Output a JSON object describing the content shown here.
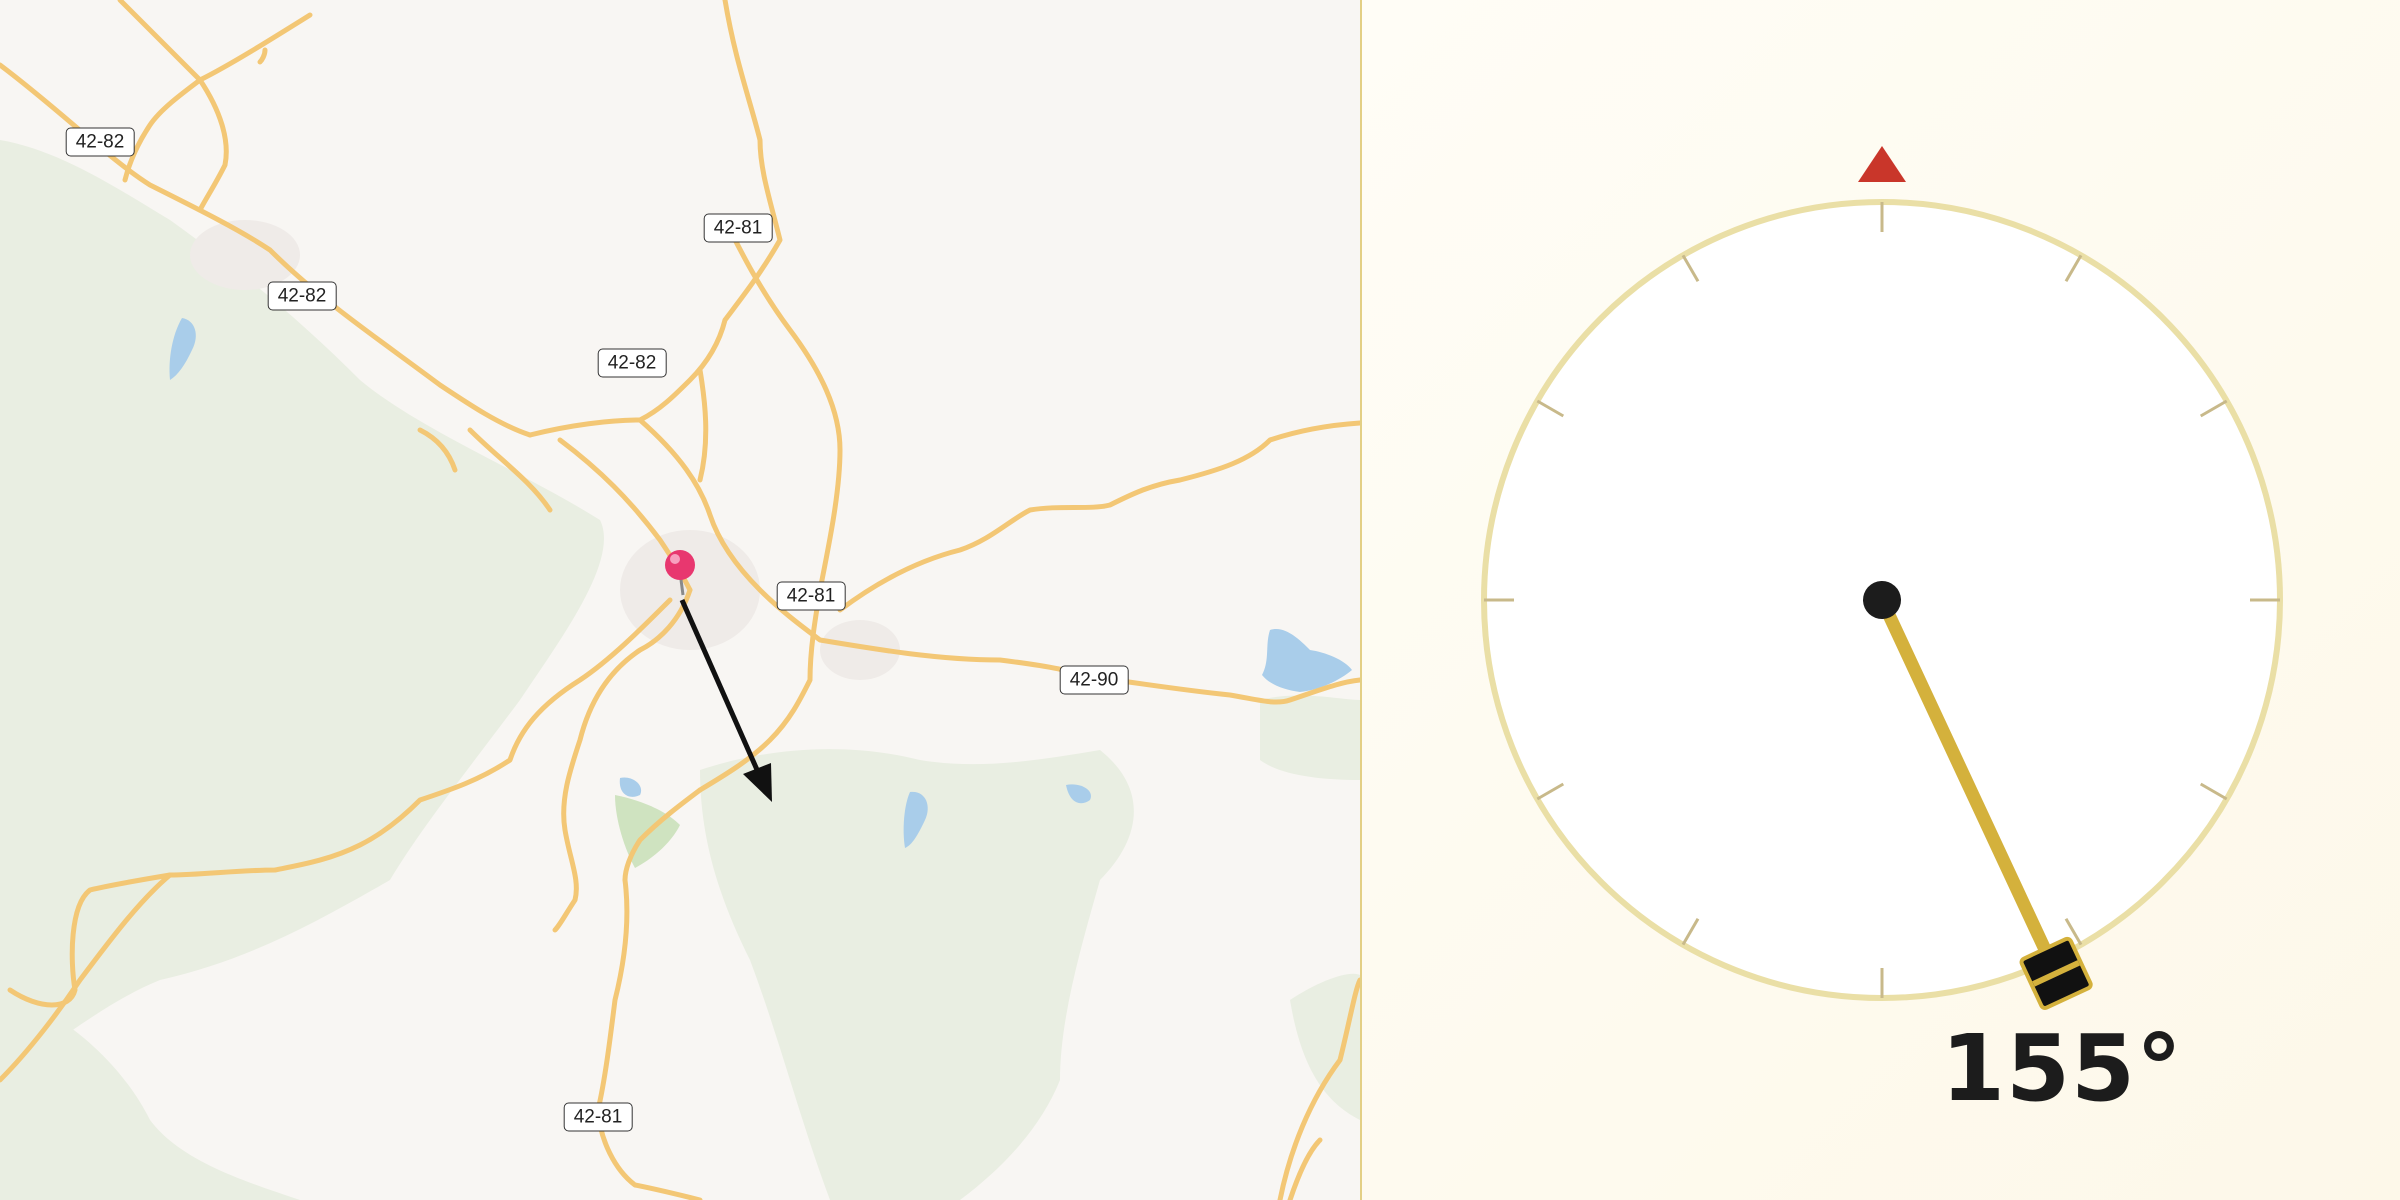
{
  "map": {
    "route_shields": [
      {
        "id": "s1",
        "label": "42-82"
      },
      {
        "id": "s2",
        "label": "42-82"
      },
      {
        "id": "s3",
        "label": "42-82"
      },
      {
        "id": "s4",
        "label": "42-81"
      },
      {
        "id": "s5",
        "label": "42-81"
      },
      {
        "id": "s6",
        "label": "42-90"
      },
      {
        "id": "s7",
        "label": "42-81"
      }
    ],
    "pin_color": "#e8376f",
    "arrow_color": "#111111",
    "road_color": "#f3c775",
    "forest_color": "#e9eee2",
    "water_color": "#a9cdea",
    "park_color": "#cfe3c0"
  },
  "compass": {
    "heading_deg": 155,
    "heading_text": "155°",
    "north_marker_color": "#c9362a",
    "needle_color": "#d4b13c",
    "dial_ring_color": "#eadfa6"
  }
}
